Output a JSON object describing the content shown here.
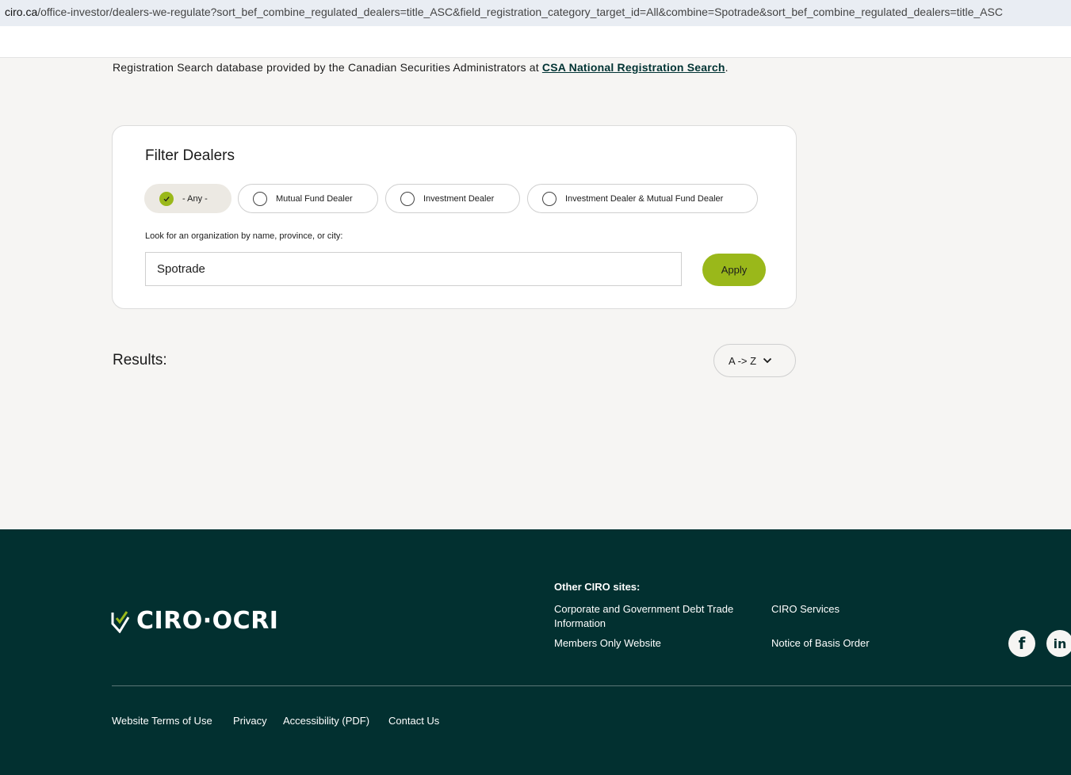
{
  "browser": {
    "url_domain": "ciro.ca",
    "url_path": "/office-investor/dealers-we-regulate?sort_bef_combine_regulated_dealers=title_ASC&field_registration_category_target_id=All&combine=Spotrade&sort_bef_combine_regulated_dealers=title_ASC"
  },
  "intro": {
    "text": "Registration Search database provided by the Canadian Securities Administrators at ",
    "link": "CSA National Registration Search",
    "end": "."
  },
  "filter": {
    "title": "Filter Dealers",
    "options": [
      {
        "label": "- Any -",
        "selected": true
      },
      {
        "label": "Mutual Fund Dealer",
        "selected": false
      },
      {
        "label": "Investment Dealer",
        "selected": false
      },
      {
        "label": "Investment Dealer & Mutual Fund Dealer",
        "selected": false
      }
    ],
    "search_label": "Look for an organization by name, province, or city:",
    "search_value": "Spotrade",
    "apply_label": "Apply"
  },
  "results": {
    "label": "Results:",
    "sort_value": "A -> Z"
  },
  "footer": {
    "logo_text": "CIRO·OCRI",
    "other_title": "Other CIRO sites:",
    "links": {
      "corporate": "Corporate and Government Debt Trade Information",
      "services": "CIRO Services",
      "members": "Members Only Website",
      "notice": "Notice of Basis Order"
    },
    "social": {
      "facebook": "f",
      "linkedin": "in"
    },
    "bottom_links": [
      "Website Terms of Use",
      "Privacy",
      "Accessibility (PDF)",
      "Contact Us"
    ]
  },
  "colors": {
    "accent": "#9ab81a",
    "footer_bg": "#023030",
    "page_bg": "#f6f5f3"
  }
}
